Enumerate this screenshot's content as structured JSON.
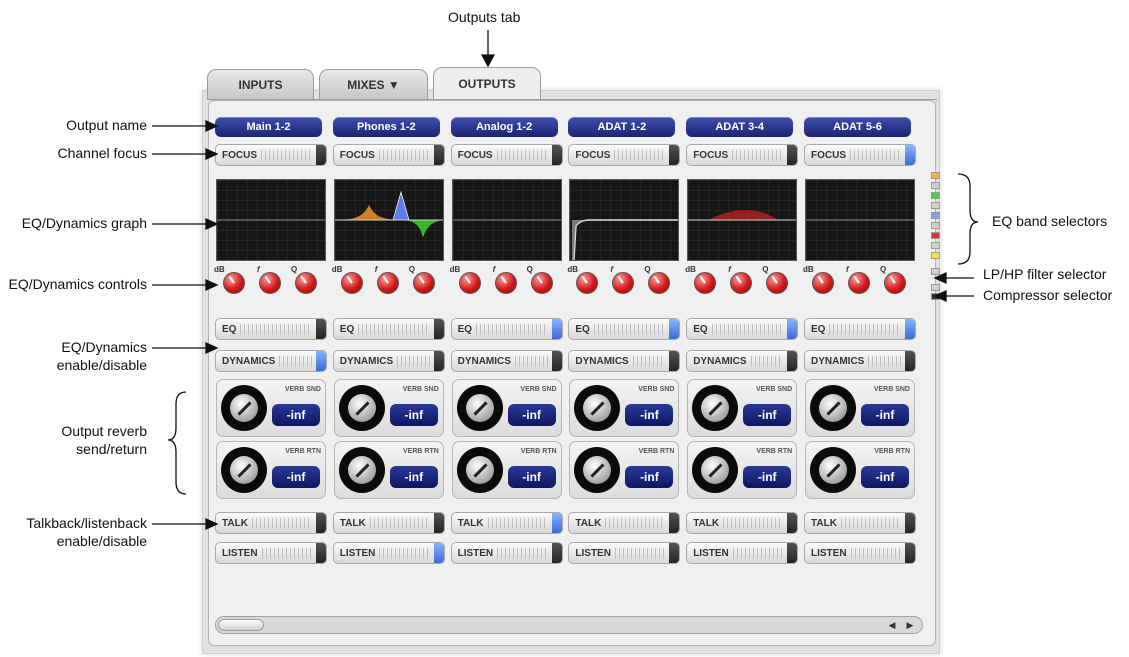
{
  "annotations": {
    "outputs_tab": "Outputs tab",
    "output_name": "Output name",
    "channel_focus": "Channel focus",
    "eq_graph": "EQ/Dynamics graph",
    "eq_controls": "EQ/Dynamics controls",
    "eq_enable_l1": "EQ/Dynamics",
    "eq_enable_l2": "enable/disable",
    "reverb_l1": "Output reverb",
    "reverb_l2": "send/return",
    "talk_l1": "Talkback/listenback",
    "talk_l2": "enable/disable",
    "eq_band_selectors": "EQ band selectors",
    "lp_hp_filter": "LP/HP filter selector",
    "compressor": "Compressor selector"
  },
  "tabs": [
    {
      "label": "INPUTS",
      "active": false
    },
    {
      "label": "MIXES ▼",
      "active": false
    },
    {
      "label": "OUTPUTS",
      "active": true
    }
  ],
  "channels": [
    {
      "name": "Main 1-2",
      "focus": "FOCUS",
      "eq": "EQ",
      "dyn": "DYNAMICS",
      "verb_snd_label": "VERB SND",
      "verb_snd": "-inf",
      "verb_rtn_label": "VERB RTN",
      "verb_rtn": "-inf",
      "talk": "TALK",
      "listen": "LISTEN",
      "knob_labels": [
        "dB",
        "f",
        "Q"
      ],
      "graph": "flat"
    },
    {
      "name": "Phones 1-2",
      "focus": "FOCUS",
      "eq": "EQ",
      "dyn": "DYNAMICS",
      "verb_snd_label": "VERB SND",
      "verb_snd": "-inf",
      "verb_rtn_label": "VERB RTN",
      "verb_rtn": "-inf",
      "talk": "TALK",
      "listen": "LISTEN",
      "knob_labels": [
        "dB",
        "f",
        "Q"
      ],
      "graph": "bands"
    },
    {
      "name": "Analog 1-2",
      "focus": "FOCUS",
      "eq": "EQ",
      "dyn": "DYNAMICS",
      "verb_snd_label": "VERB SND",
      "verb_snd": "-inf",
      "verb_rtn_label": "VERB RTN",
      "verb_rtn": "-inf",
      "talk": "TALK",
      "listen": "LISTEN",
      "knob_labels": [
        "dB",
        "f",
        "Q"
      ],
      "graph": "flat"
    },
    {
      "name": "ADAT 1-2",
      "focus": "FOCUS",
      "eq": "EQ",
      "dyn": "DYNAMICS",
      "verb_snd_label": "VERB SND",
      "verb_snd": "-inf",
      "verb_rtn_label": "VERB RTN",
      "verb_rtn": "-inf",
      "talk": "TALK",
      "listen": "LISTEN",
      "knob_labels": [
        "dB",
        "f",
        "Q"
      ],
      "graph": "hipass"
    },
    {
      "name": "ADAT 3-4",
      "focus": "FOCUS",
      "eq": "EQ",
      "dyn": "DYNAMICS",
      "verb_snd_label": "VERB SND",
      "verb_snd": "-inf",
      "verb_rtn_label": "VERB RTN",
      "verb_rtn": "-inf",
      "talk": "TALK",
      "listen": "LISTEN",
      "knob_labels": [
        "dB",
        "f",
        "Q"
      ],
      "graph": "bump"
    },
    {
      "name": "ADAT 5-6",
      "focus": "FOCUS",
      "eq": "EQ",
      "dyn": "DYNAMICS",
      "verb_snd_label": "VERB SND",
      "verb_snd": "-inf",
      "verb_rtn_label": "VERB RTN",
      "verb_rtn": "-inf",
      "talk": "TALK",
      "listen": "LISTEN",
      "knob_labels": [
        "dB",
        "f",
        "Q"
      ],
      "graph": "flat"
    }
  ],
  "toggle_states": {
    "focus": [
      false,
      false,
      false,
      false,
      false,
      true
    ],
    "eq": [
      false,
      false,
      true,
      true,
      true,
      true
    ],
    "dynamics": [
      true,
      false,
      false,
      false,
      false,
      false
    ],
    "talk": [
      false,
      false,
      true,
      false,
      false,
      false
    ],
    "listen": [
      false,
      true,
      false,
      false,
      false,
      false
    ]
  },
  "band_selector_colors": [
    "#f0b04a",
    "#55c84a",
    "#7aa3e6",
    "#d33a3a",
    "#f0e24a"
  ],
  "graph_colors": {
    "low": "#e28a2c",
    "mid": "#5b7ee8",
    "high": "#39b52b",
    "bump": "#b32020",
    "hipass": "#bbbbbb"
  }
}
